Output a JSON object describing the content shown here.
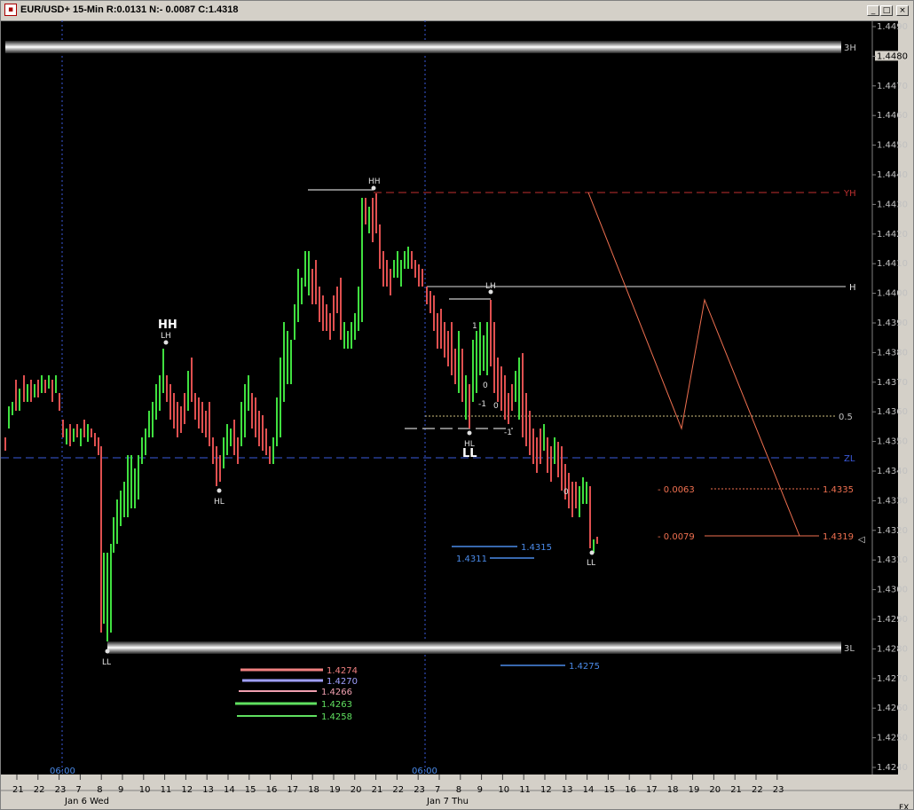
{
  "window": {
    "title": "EUR/USD+ 15-Min R:0.0131 N:- 0.0087 C:1.4318",
    "controls": [
      "_",
      "□",
      "×"
    ]
  },
  "axis": {
    "price_ticks": [
      "1.4490",
      "1.4480",
      "1.4470",
      "1.4460",
      "1.4450",
      "1.4440",
      "1.4430",
      "1.4420",
      "1.4410",
      "1.4400",
      "1.4390",
      "1.4380",
      "1.4370",
      "1.4360",
      "1.4350",
      "1.4340",
      "1.4330",
      "1.4320",
      "1.4310",
      "1.4300",
      "1.4290",
      "1.4280",
      "1.4270",
      "1.4260",
      "1.4250",
      "1.4240"
    ],
    "highlighted_tick": "1.4480",
    "hour_labels": [
      "21",
      "22",
      "23",
      "7",
      "8",
      "9",
      "10",
      "11",
      "12",
      "13",
      "14",
      "15",
      "16",
      "17",
      "18",
      "19",
      "20",
      "21",
      "22",
      "23",
      "7",
      "8",
      "9",
      "10",
      "11",
      "12",
      "13",
      "14",
      "15",
      "16",
      "17",
      "18",
      "19",
      "20",
      "21",
      "22",
      "23"
    ],
    "day_labels": [
      "Jan 6 Wed",
      "Jan 7 Thu"
    ],
    "time_markers": [
      "06:00",
      "06:00"
    ],
    "corner_label": "FX"
  },
  "levels": {
    "upper_band": "3H",
    "lower_band": "3L",
    "yesterday_high": "YH",
    "high": "H",
    "half": "0.5",
    "zero_line": "ZL",
    "target_1": {
      "diff": "- 0.0063",
      "price": "1.4335"
    },
    "target_2": {
      "diff": "- 0.0079",
      "price": "1.4319"
    }
  },
  "swing_labels": {
    "hh_big": "HH",
    "lh_1": "LH",
    "hl_1": "HL",
    "ll_1": "LL",
    "hh_2": "HH",
    "lh_2": "LH",
    "hl_2": "HL",
    "ll_big": "LL",
    "ll_2": "LL"
  },
  "wave_counts": [
    "1",
    "0",
    "-1",
    "0",
    "-1",
    "0"
  ],
  "price_tags": {
    "mid_1": "1.4315",
    "mid_2": "1.4311",
    "mid_3": "1.4275",
    "stack": [
      "1.4274",
      "1.4270",
      "1.4266",
      "1.4263",
      "1.4258"
    ]
  },
  "colors": {
    "up_bar": "#40e040",
    "down_bar": "#e05050",
    "zero_line": "#3a5adc",
    "yh_line": "#c03030",
    "projection": "#f07050"
  }
}
